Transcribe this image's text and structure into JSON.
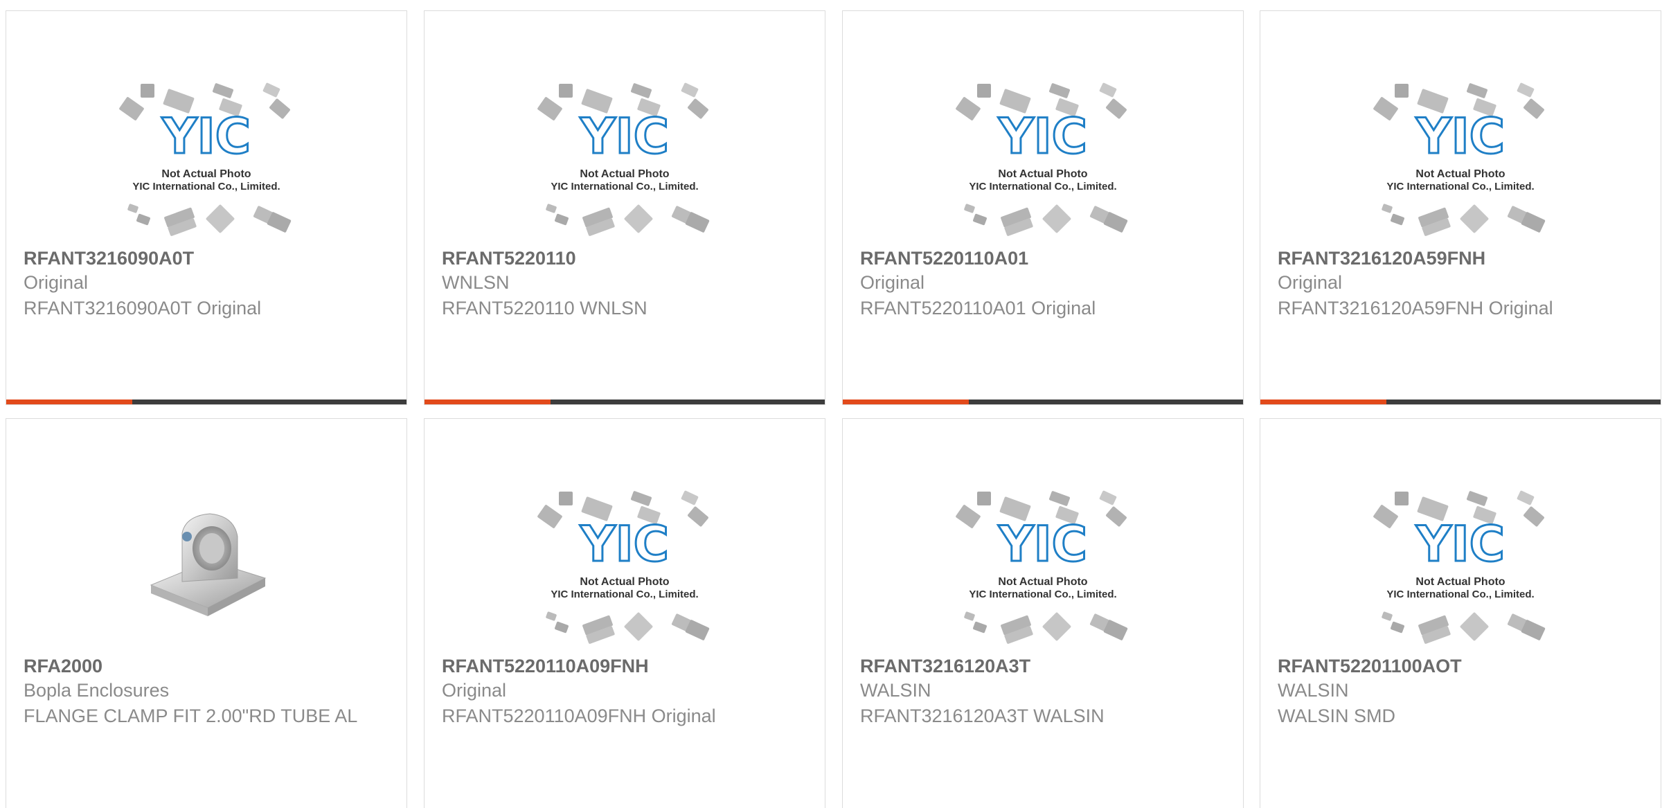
{
  "colors": {
    "accent": "#e24a1b",
    "bar": "#3d3d3d",
    "logo": "#1f7fc6"
  },
  "placeholder": {
    "logo_text": "YIC",
    "line1": "Not Actual Photo",
    "line2": "YIC International Co., Limited."
  },
  "products": [
    {
      "part": "RFANT3216090A0T",
      "manufacturer": "Original",
      "description": "RFANT3216090A0T Original",
      "image": "placeholder-chips"
    },
    {
      "part": "RFANT5220110",
      "manufacturer": "WNLSN",
      "description": "RFANT5220110 WNLSN",
      "image": "placeholder-chips"
    },
    {
      "part": "RFANT5220110A01",
      "manufacturer": "Original",
      "description": "RFANT5220110A01 Original",
      "image": "placeholder-chips"
    },
    {
      "part": "RFANT3216120A59FNH",
      "manufacturer": "Original",
      "description": "RFANT3216120A59FNH Original",
      "image": "placeholder-chips"
    },
    {
      "part": "RFA2000",
      "manufacturer": "Bopla Enclosures",
      "description": "FLANGE CLAMP FIT 2.00\"RD TUBE AL",
      "image": "flange-clamp-photo"
    },
    {
      "part": "RFANT5220110A09FNH",
      "manufacturer": "Original",
      "description": "RFANT5220110A09FNH Original",
      "image": "placeholder-chips"
    },
    {
      "part": "RFANT3216120A3T",
      "manufacturer": "WALSIN",
      "description": "RFANT3216120A3T WALSIN",
      "image": "placeholder-chips"
    },
    {
      "part": "RFANT52201100AOT",
      "manufacturer": "WALSIN",
      "description": "WALSIN SMD",
      "image": "placeholder-chips"
    }
  ]
}
